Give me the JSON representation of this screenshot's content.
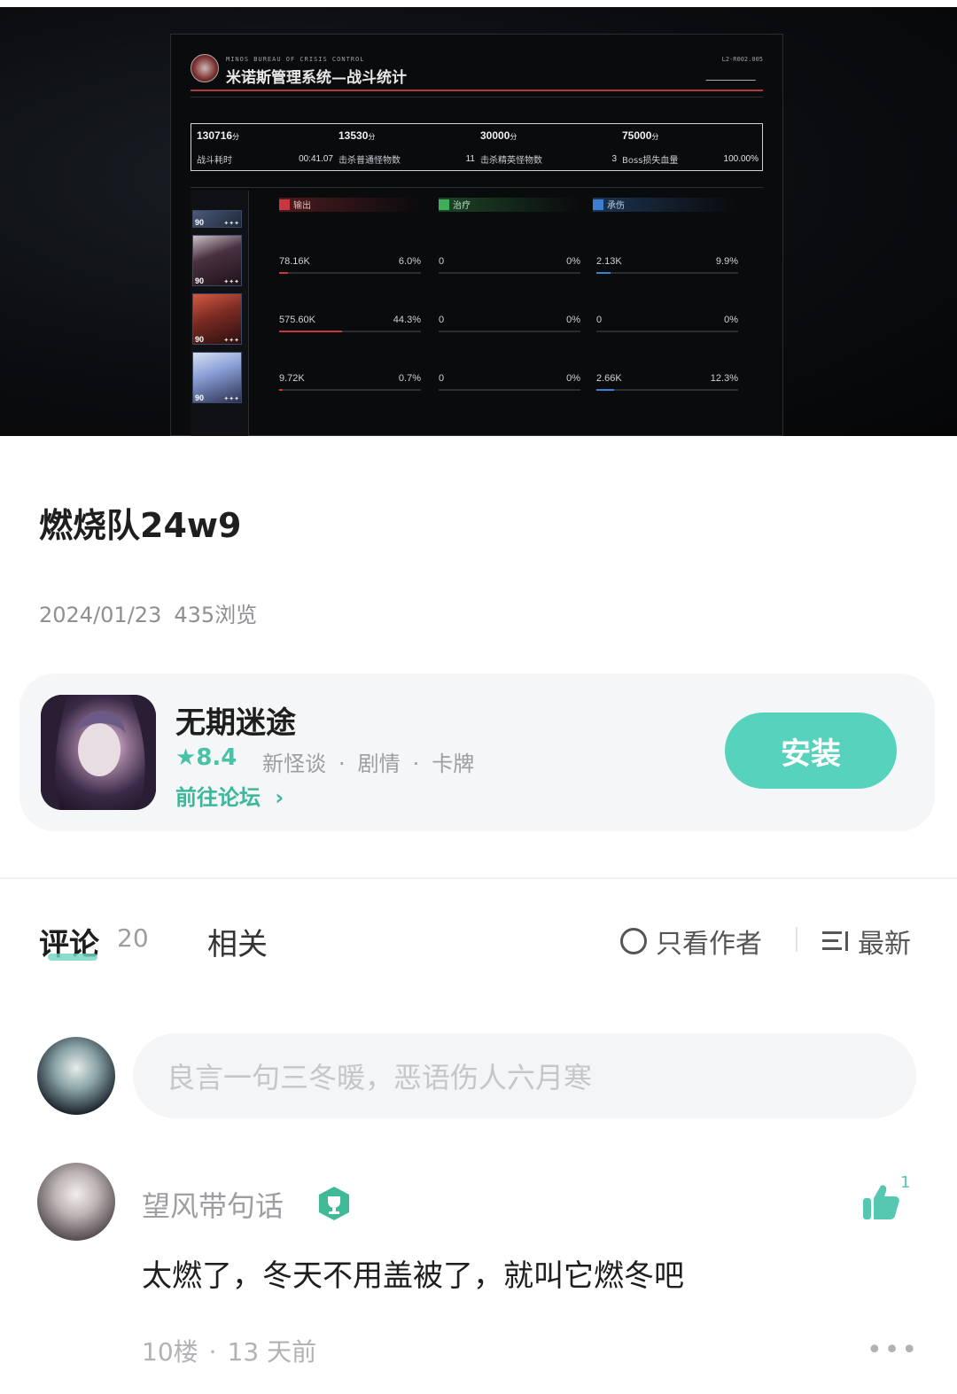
{
  "battle_screen": {
    "bureau_line": "MINOS BUREAU OF CRISIS CONTROL",
    "title": "米诺斯管理系统—战斗统计",
    "doc_code": "L2-R002.005",
    "stats": [
      {
        "score": "130716",
        "unit": "分",
        "label": "战斗耗时",
        "value": "00:41.07"
      },
      {
        "score": "13530",
        "unit": "分",
        "label": "击杀普通怪物数",
        "value": "11"
      },
      {
        "score": "30000",
        "unit": "分",
        "label": "击杀精英怪物数",
        "value": "3"
      },
      {
        "score": "75000",
        "unit": "分",
        "label": "Boss损失血量",
        "value": "100.00%"
      }
    ],
    "categories": [
      {
        "label": "输出",
        "color": "#c8373f"
      },
      {
        "label": "治疗",
        "color": "#3fae5a"
      },
      {
        "label": "承伤",
        "color": "#3c7fd0"
      }
    ],
    "characters": [
      {
        "level": "90",
        "stars": "✦✦✦"
      },
      {
        "level": "90",
        "stars": "✦✦✦"
      },
      {
        "level": "90",
        "stars": "✦✦✦"
      },
      {
        "level": "90",
        "stars": "✦✦✦"
      }
    ],
    "rows": [
      {
        "output": {
          "value": "78.16K",
          "pct": "6.0%",
          "fraction": 0.06
        },
        "healing": {
          "value": "0",
          "pct": "0%",
          "fraction": 0
        },
        "tanking": {
          "value": "2.13K",
          "pct": "9.9%",
          "fraction": 0.099
        }
      },
      {
        "output": {
          "value": "575.60K",
          "pct": "44.3%",
          "fraction": 0.443
        },
        "healing": {
          "value": "0",
          "pct": "0%",
          "fraction": 0
        },
        "tanking": {
          "value": "0",
          "pct": "0%",
          "fraction": 0
        }
      },
      {
        "output": {
          "value": "9.72K",
          "pct": "0.7%",
          "fraction": 0.007
        },
        "healing": {
          "value": "0",
          "pct": "0%",
          "fraction": 0
        },
        "tanking": {
          "value": "2.66K",
          "pct": "12.3%",
          "fraction": 0.123
        }
      }
    ]
  },
  "post": {
    "title": "燃烧队24w9",
    "date": "2024/01/23",
    "views": "435浏览"
  },
  "game_card": {
    "name": "无期迷途",
    "rating": "8.4",
    "star_icon": "star-icon",
    "tags": [
      "新怪谈",
      "剧情",
      "卡牌"
    ],
    "forum_link": "前往论坛",
    "install_label": "安装",
    "accent": "#56d2bd"
  },
  "tabs": {
    "comments_label": "评论",
    "comments_count": "20",
    "related_label": "相关",
    "only_author_label": "只看作者",
    "sort_label": "最新"
  },
  "comment_input": {
    "placeholder": "良言一句三冬暖，恶语伤人六月寒"
  },
  "comments": [
    {
      "user": "望风带句话",
      "text": "太燃了，冬天不用盖被了，就叫它燃冬吧",
      "floor": "10楼",
      "time": "13 天前",
      "likes": "1"
    }
  ]
}
